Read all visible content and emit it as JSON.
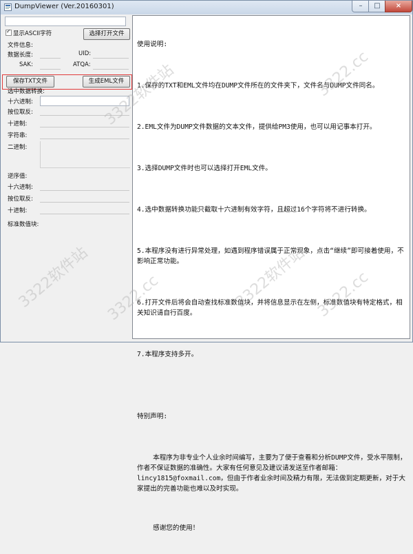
{
  "window": {
    "title": "DumpViewer (Ver.20160301)",
    "close_glyph": "×",
    "min_glyph": "–",
    "max_glyph": "□"
  },
  "left": {
    "show_ascii_label": "显示ASCII字符",
    "show_ascii_checked": true,
    "open_button": "选择打开文件",
    "file_info_label": "文件信息:",
    "data_length_label": "数据长度:",
    "uid_label": "UID:",
    "sak_label": "SAK:",
    "atqa_label": "ATQA:",
    "save_txt_button": "保存TXT文件",
    "gen_eml_button": "生成EML文件",
    "selected_convert_label": "选中数据转换:",
    "hex_label": "十六进制:",
    "byte_reverse_label": "按位取反:",
    "decimal_label": "十进制:",
    "string_label": "字符串:",
    "binary_label": "二进制:",
    "reverse_label": "逆序值:",
    "rev_hex_label": "十六进制:",
    "rev_byte_reverse_label": "按位取反:",
    "rev_decimal_label": "十进制:",
    "std_value_label": "标准数值块:"
  },
  "doc": {
    "heading": "使用说明:",
    "p1": "1.保存的TXT和EML文件均在DUMP文件所在的文件夹下，文件名与DUMP文件同名。",
    "p2": "2.EML文件为DUMP文件数据的文本文件，提供给PM3使用，也可以用记事本打开。",
    "p3": "3.选择DUMP文件时也可以选择打开EML文件。",
    "p4": "4.选中数据转换功能只截取十六进制有效字符，且超过16个字符将不进行转换。",
    "p5": "5.本程序没有进行异常处理，如遇到程序错误属于正常现象，点击“继续”即可接着使用，不影响正常功能。",
    "p6": "6.打开文件后将会自动查找标准数值块，并将信息显示在左侧，标准数值块有特定格式，相关知识请自行百度。",
    "p7": "7.本程序支持多开。",
    "special_heading": "特别声明:",
    "special_body": "    本程序为非专业个人业余时间编写，主要为了便于查看和分析DUMP文件，受水平限制，作者不保证数据的准确性。大家有任何意见及建议请发送至作者邮箱：lincy1815@foxmail.com，但由于作者业余时间及精力有限，无法做到定期更新，对于大家提出的完善功能也难以及时实现。",
    "thanks": "    感谢您的使用！"
  },
  "watermarks": [
    "3322软件站",
    "3322.cc",
    "3322软件站",
    "3322.cc",
    "3322软件站",
    "3322.cc"
  ]
}
